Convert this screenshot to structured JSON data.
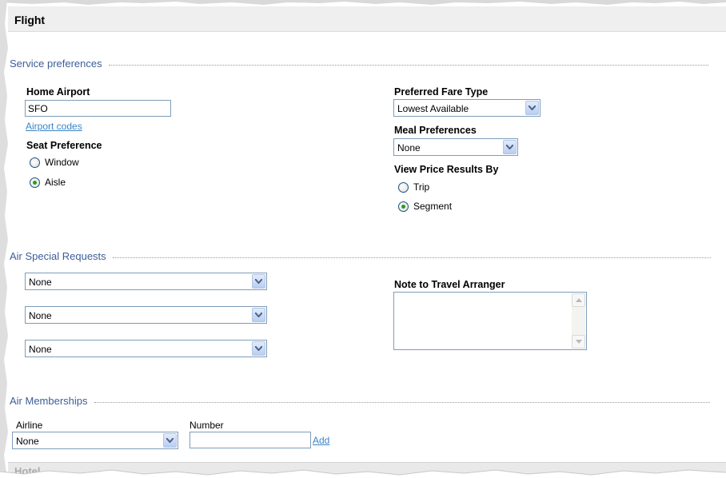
{
  "header": {
    "title": "Flight"
  },
  "sections": {
    "service": "Service preferences",
    "special": "Air Special Requests",
    "memberships": "Air Memberships"
  },
  "service": {
    "home_airport_label": "Home Airport",
    "home_airport_value": "SFO",
    "airport_codes_link": "Airport codes",
    "seat_label": "Seat Preference",
    "seat_options": [
      {
        "label": "Window",
        "selected": false
      },
      {
        "label": "Aisle",
        "selected": true
      }
    ],
    "fare_label": "Preferred Fare Type",
    "fare_value": "Lowest Available",
    "meal_label": "Meal Preferences",
    "meal_value": "None",
    "view_price_label": "View Price Results By",
    "view_price_options": [
      {
        "label": "Trip",
        "selected": false
      },
      {
        "label": "Segment",
        "selected": true
      }
    ]
  },
  "special_requests": {
    "selects": [
      "None",
      "None",
      "None"
    ],
    "note_label": "Note to Travel Arranger",
    "note_value": ""
  },
  "memberships": {
    "airline_label": "Airline",
    "airline_value": "None",
    "number_label": "Number",
    "number_value": "",
    "add_link": "Add"
  },
  "footer": {
    "partial_text": "Hotel"
  },
  "colors": {
    "section_title": "#3d5d98",
    "link": "#3a84c6",
    "radio_dot": "#21a121",
    "input_border": "#7f9db9"
  }
}
